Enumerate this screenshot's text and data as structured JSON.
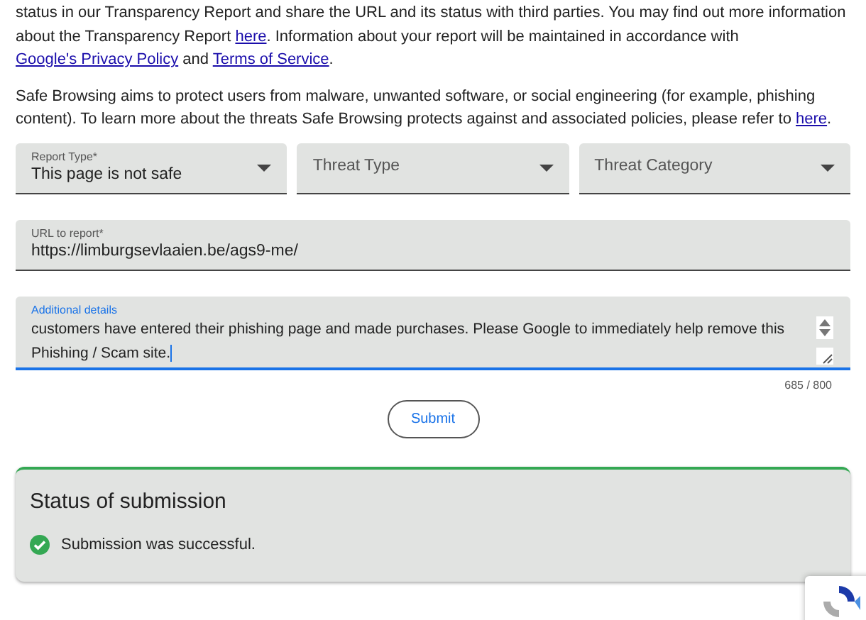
{
  "intro_paragraphs": [
    {
      "parts": [
        {
          "kind": "text",
          "text": "status in our Transparency Report and share the URL and its status with third parties. You may find out more information about the Transparency Report "
        },
        {
          "kind": "link",
          "text": "here"
        },
        {
          "kind": "text",
          "text": ". Information about your report will be maintained in accordance with "
        },
        {
          "kind": "link",
          "text": "Google's Privacy Policy"
        },
        {
          "kind": "text",
          "text": " and "
        },
        {
          "kind": "link",
          "text": "Terms of Service"
        },
        {
          "kind": "text",
          "text": "."
        }
      ]
    },
    {
      "parts": [
        {
          "kind": "text",
          "text": "Safe Browsing aims to protect users from malware, unwanted software, or social engineering (for example, phishing content). To learn more about the threats Safe Browsing protects against and associated policies, please refer to "
        },
        {
          "kind": "link",
          "text": "here"
        },
        {
          "kind": "text",
          "text": "."
        }
      ]
    }
  ],
  "selects": [
    {
      "label": "Report Type*",
      "value": "This page is not safe"
    },
    {
      "placeholder": "Threat Type"
    },
    {
      "placeholder": "Threat Category"
    }
  ],
  "url_field": {
    "label": "URL to report*",
    "value": "https://limburgsevlaaien.be/ags9-me/"
  },
  "details_field": {
    "label": "Additional details",
    "value": "customers have entered their phishing page and made purchases. Please Google to immediately help remove this Phishing / Scam site.",
    "focused": true,
    "counter": "685 / 800"
  },
  "submit_button": "Submit",
  "status": {
    "title": "Status of submission",
    "message": "Submission was successful.",
    "success": true
  }
}
